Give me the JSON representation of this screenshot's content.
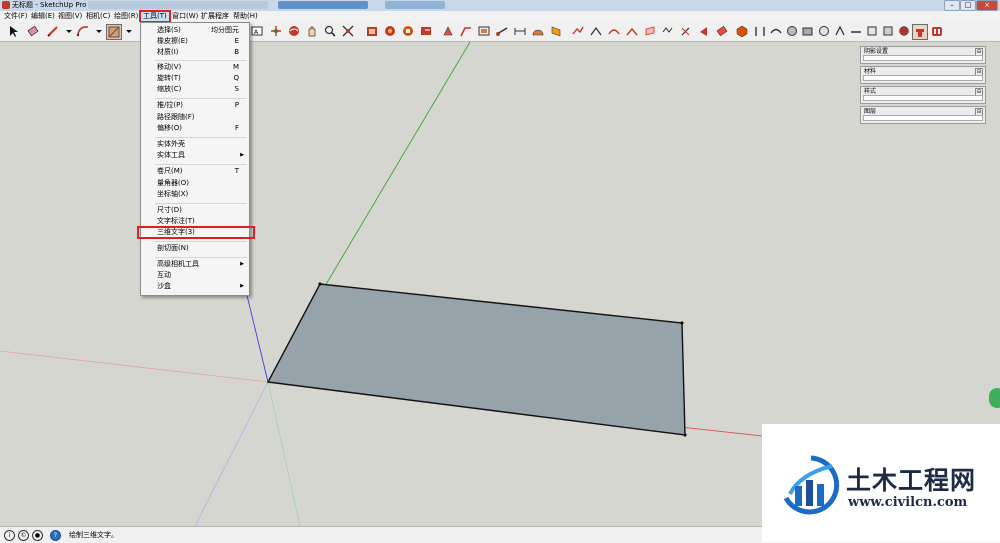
{
  "window": {
    "title": "无标题 - SketchUp Pro"
  },
  "menubar": {
    "file": "文件(F)",
    "edit": "编辑(E)",
    "view": "视图(V)",
    "camera": "相机(C)",
    "draw": "绘图(R)",
    "tools": "工具(T)",
    "window": "窗口(W)",
    "extensions": "扩展程序",
    "help": "帮助(H)"
  },
  "tools_menu": {
    "items": [
      {
        "label": "选择(S)",
        "shortcut": "均分图元"
      },
      {
        "label": "橡皮擦(E)",
        "shortcut": "E"
      },
      {
        "label": "材质(I)",
        "shortcut": "B"
      },
      {
        "label": "移动(V)",
        "shortcut": "M"
      },
      {
        "label": "旋转(T)",
        "shortcut": "Q"
      },
      {
        "label": "缩放(C)",
        "shortcut": "S"
      },
      {
        "label": "推/拉(P)",
        "shortcut": "P"
      },
      {
        "label": "路径跟随(F)",
        "shortcut": ""
      },
      {
        "label": "偏移(O)",
        "shortcut": "F"
      },
      {
        "label": "实体外壳",
        "shortcut": ""
      },
      {
        "label": "实体工具",
        "shortcut": ""
      },
      {
        "label": "卷尺(M)",
        "shortcut": "T"
      },
      {
        "label": "量角器(O)",
        "shortcut": ""
      },
      {
        "label": "坐标轴(X)",
        "shortcut": ""
      },
      {
        "label": "尺寸(D)",
        "shortcut": ""
      },
      {
        "label": "文字标注(T)",
        "shortcut": ""
      },
      {
        "label": "三维文字(3)",
        "shortcut": ""
      },
      {
        "label": "剖切面(N)",
        "shortcut": ""
      },
      {
        "label": "高级相机工具",
        "shortcut": ""
      },
      {
        "label": "互动",
        "shortcut": ""
      },
      {
        "label": "沙盒",
        "shortcut": ""
      }
    ]
  },
  "panels": {
    "shadow": "阴影设置",
    "materials": "材料",
    "styles": "样式",
    "layers": "图层",
    "expand_glyph": "⊟"
  },
  "status": {
    "message": "绘制三维文字。"
  },
  "watermark": {
    "title": "土木工程网",
    "url": "www.civilcn.com"
  },
  "colors": {
    "highlight_red": "#e02020",
    "face_fill": "#97a3ab",
    "axis_red": "#d94a4a",
    "axis_green": "#3aa33a",
    "axis_blue": "#3a3ad8",
    "background": "#d6d6d0"
  }
}
